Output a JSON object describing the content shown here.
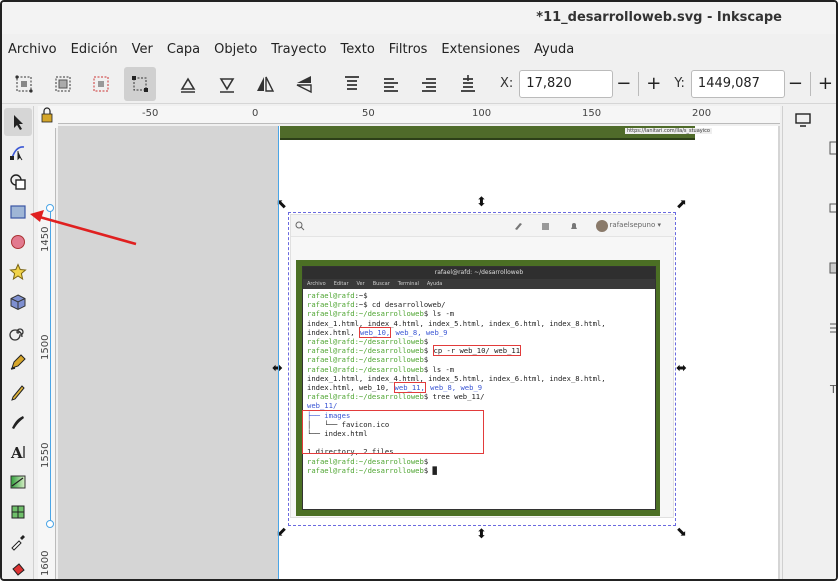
{
  "window": {
    "title": "*11_desarrolloweb.svg - Inkscape"
  },
  "menu": [
    "Archivo",
    "Edición",
    "Ver",
    "Capa",
    "Objeto",
    "Trayecto",
    "Texto",
    "Filtros",
    "Extensiones",
    "Ayuda"
  ],
  "controls": {
    "x_label": "X:",
    "x_value": "17,820",
    "y_label": "Y:",
    "y_value": "1449,087",
    "minus": "−",
    "plus": "+"
  },
  "ruler_top": [
    "-50",
    "0",
    "50",
    "100",
    "150",
    "200"
  ],
  "ruler_left": [
    "1450",
    "1500",
    "1550",
    "1600"
  ],
  "image": {
    "url_text": "https://lanitari.com/lla/s_stuayico",
    "user": "rafaelsepuno ▾",
    "terminal": {
      "title": "rafael@rafd: ~/desarrolloweb",
      "menu": [
        "Archivo",
        "Editar",
        "Ver",
        "Buscar",
        "Terminal",
        "Ayuda"
      ],
      "l1_prompt": "rafael@rafd",
      "l1_rest": ":~$",
      "l2_prompt": "rafael@rafd",
      "l2_rest": ":~$ cd desarrolloweb/",
      "l3_prompt": "rafael@rafd:~/desarrolloweb",
      "l3_rest": "$ ls -m",
      "l4": "index_1.html, index_4.html, index_5.html, index_6.html, index_8.html,",
      "l5_a": "index.html, ",
      "l5_b": "web_10,",
      "l5_c": " web_8, web_9",
      "l6_prompt": "rafael@rafd:~/desarrolloweb",
      "l6_rest": "$",
      "l7_prompt": "rafael@rafd:~/desarrolloweb",
      "l7_rest": "$ ",
      "l7_cmd": "cp -r web_10/ web_11",
      "l8_prompt": "rafael@rafd:~/desarrolloweb",
      "l8_rest": "$",
      "l9_prompt": "rafael@rafd:~/desarrolloweb",
      "l9_rest": "$ ls -m",
      "l10": "index_1.html, index_4.html, index_5.html, index_6.html, index_8.html,",
      "l11_a": "index.html, web_10, ",
      "l11_b": "web_11,",
      "l11_c": " web_8, web_9",
      "l12_prompt": "rafael@rafd:~/desarrolloweb",
      "l12_rest": "$ tree web_11/",
      "l13": "web_11/",
      "l14": "├── images",
      "l15": "│   └── favicon.ico",
      "l16": "└── index.html",
      "l17": "",
      "l18": "1 directory, 2 files",
      "l19_prompt": "rafael@rafd:~/desarrolloweb",
      "l19_rest": "$",
      "l20_prompt": "rafael@rafd:~/desarrolloweb",
      "l20_rest": "$ ",
      "cursor": "█"
    }
  },
  "colors": {
    "arrow": "#e02020",
    "guide": "#4aa5e6",
    "prompt": "#4ea531",
    "dir": "#3a56d4",
    "highlight": "#e23b3b"
  }
}
